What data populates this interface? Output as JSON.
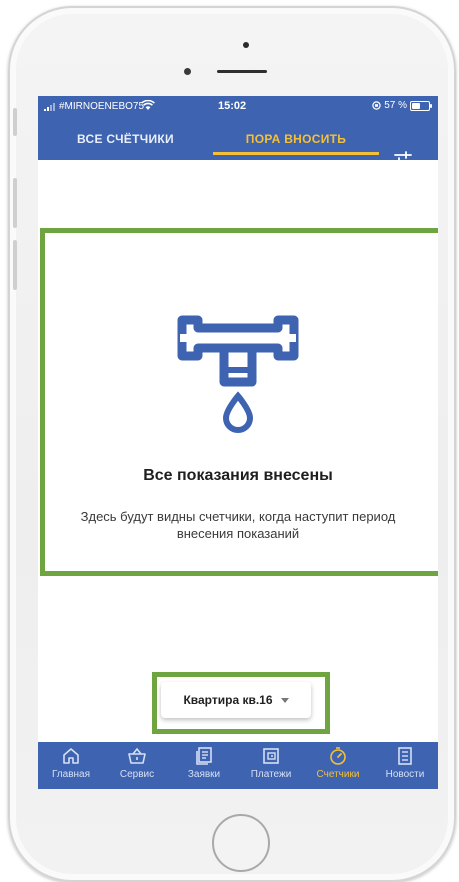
{
  "status_bar": {
    "carrier": "#MIRNOENEBO75",
    "time": "15:02",
    "battery": "57 %",
    "battery_level": 0.57
  },
  "tabs": [
    {
      "label": "ВСЕ СЧЁТЧИКИ",
      "active": false
    },
    {
      "label": "ПОРА ВНОСИТЬ",
      "active": true
    }
  ],
  "empty_state": {
    "icon": "faucet-drop-icon",
    "title": "Все показания внесены",
    "description": "Здесь будут видны счетчики, когда наступит период внесения показаний"
  },
  "apartment_selector": {
    "value": "Квартира кв.16"
  },
  "bottom_nav": [
    {
      "label": "Главная",
      "icon": "home-icon",
      "active": false
    },
    {
      "label": "Сервис",
      "icon": "basket-icon",
      "active": false
    },
    {
      "label": "Заявки",
      "icon": "requests-icon",
      "active": false
    },
    {
      "label": "Платежи",
      "icon": "wallet-icon",
      "active": false
    },
    {
      "label": "Счетчики",
      "icon": "meter-icon",
      "active": true
    },
    {
      "label": "Новости",
      "icon": "news-icon",
      "active": false
    }
  ],
  "colors": {
    "primary": "#3e63b0",
    "accent": "#f5c035",
    "highlight": "#6ea541"
  }
}
